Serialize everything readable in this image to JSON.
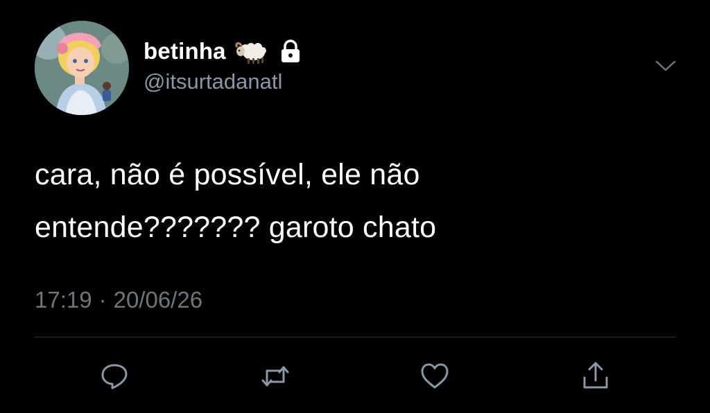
{
  "tweet": {
    "display_name": "betinha",
    "handle": "@itsurtadanatl",
    "text_line1": "cara, não é possível, ele não",
    "text_line2": "entende??????? garoto chato",
    "time": "17:19",
    "separator": "·",
    "date": "20/06/26"
  },
  "icons": {
    "name_emoji": "sheep-icon",
    "protected": "lock-icon",
    "menu": "chevron-down-icon",
    "actions": [
      "reply-icon",
      "retweet-icon",
      "like-icon",
      "share-icon"
    ]
  },
  "colors": {
    "background": "#000000",
    "text": "#ffffff",
    "secondary": "#8b98a5",
    "timestamp": "#6e767d",
    "icon": "#8b98a5",
    "divider": "#2f3336"
  }
}
